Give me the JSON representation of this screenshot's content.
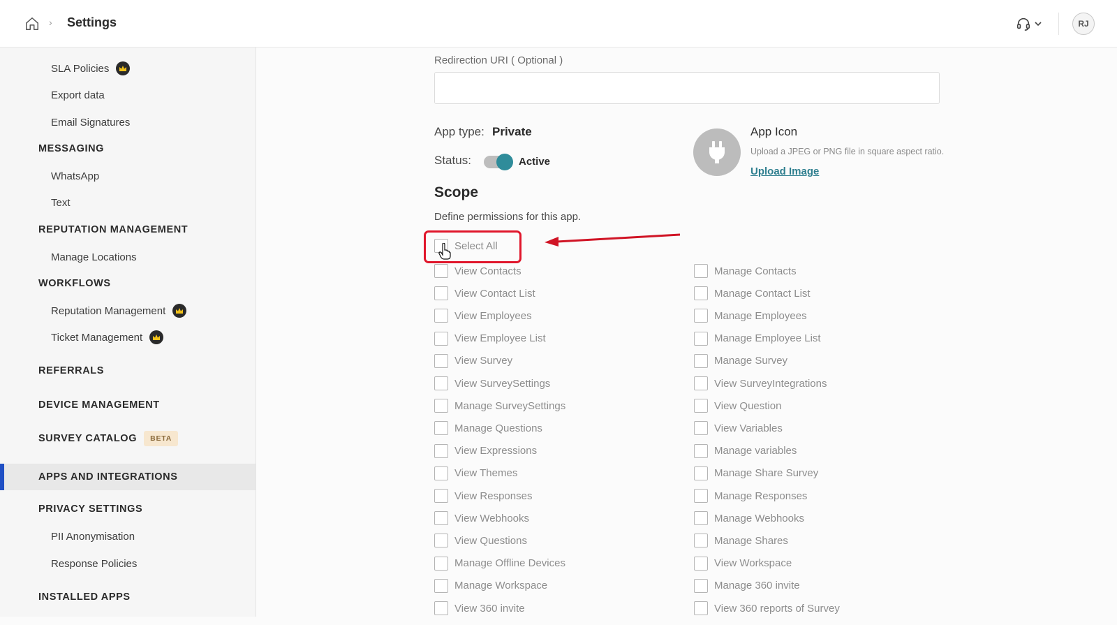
{
  "header": {
    "breadcrumb_separator": "›",
    "title": "Settings",
    "avatar_initials": "RJ"
  },
  "sidebar": {
    "items": [
      {
        "label": "SLA Policies",
        "type": "sub",
        "premium": true
      },
      {
        "label": "Export data",
        "type": "sub"
      },
      {
        "label": "Email Signatures",
        "type": "sub"
      },
      {
        "label": "MESSAGING",
        "type": "section"
      },
      {
        "label": "WhatsApp",
        "type": "sub"
      },
      {
        "label": "Text",
        "type": "sub"
      },
      {
        "label": "REPUTATION MANAGEMENT",
        "type": "section"
      },
      {
        "label": "Manage Locations",
        "type": "sub"
      },
      {
        "label": "WORKFLOWS",
        "type": "section"
      },
      {
        "label": "Reputation Management",
        "type": "sub",
        "premium": true
      },
      {
        "label": "Ticket Management",
        "type": "sub",
        "premium": true
      },
      {
        "label": "REFERRALS",
        "type": "section"
      },
      {
        "label": "DEVICE MANAGEMENT",
        "type": "section"
      },
      {
        "label": "SURVEY CATALOG",
        "type": "section",
        "badge": "BETA"
      },
      {
        "label": "APPS AND INTEGRATIONS",
        "type": "section",
        "active": true
      },
      {
        "label": "PRIVACY SETTINGS",
        "type": "section"
      },
      {
        "label": "PII Anonymisation",
        "type": "sub"
      },
      {
        "label": "Response Policies",
        "type": "sub"
      },
      {
        "label": "INSTALLED APPS",
        "type": "section"
      }
    ]
  },
  "form": {
    "redirection_label": "Redirection URI ( Optional )",
    "redirection_value": "",
    "app_type_label": "App type:",
    "app_type_value": "Private",
    "status_label": "Status:",
    "status_value": "Active",
    "status_on": true
  },
  "app_icon": {
    "title": "App Icon",
    "hint": "Upload a JPEG or PNG file in square aspect ratio.",
    "upload_label": "Upload Image"
  },
  "scope": {
    "title": "Scope",
    "description": "Define permissions for this app.",
    "select_all_label": "Select All",
    "left": [
      "View Contacts",
      "View Contact List",
      "View Employees",
      "View Employee List",
      "View Survey",
      "View SurveySettings",
      "Manage SurveySettings",
      "Manage Questions",
      "View Expressions",
      "View Themes",
      "View Responses",
      "View Webhooks",
      "View Questions",
      "Manage Offline Devices",
      "Manage Workspace",
      "View 360 invite"
    ],
    "right": [
      "Manage Contacts",
      "Manage Contact List",
      "Manage Employees",
      "Manage Employee List",
      "Manage Survey",
      "View SurveyIntegrations",
      "View Question",
      "View Variables",
      "Manage variables",
      "Manage Share Survey",
      "Manage Responses",
      "Manage Webhooks",
      "Manage Shares",
      "View Workspace",
      "Manage 360 invite",
      "View 360 reports of Survey"
    ]
  },
  "colors": {
    "accent": "#2f8c9a",
    "active_bar": "#1f4fc4",
    "highlight": "#e0162b",
    "premium_crown": "#f2c21a"
  }
}
